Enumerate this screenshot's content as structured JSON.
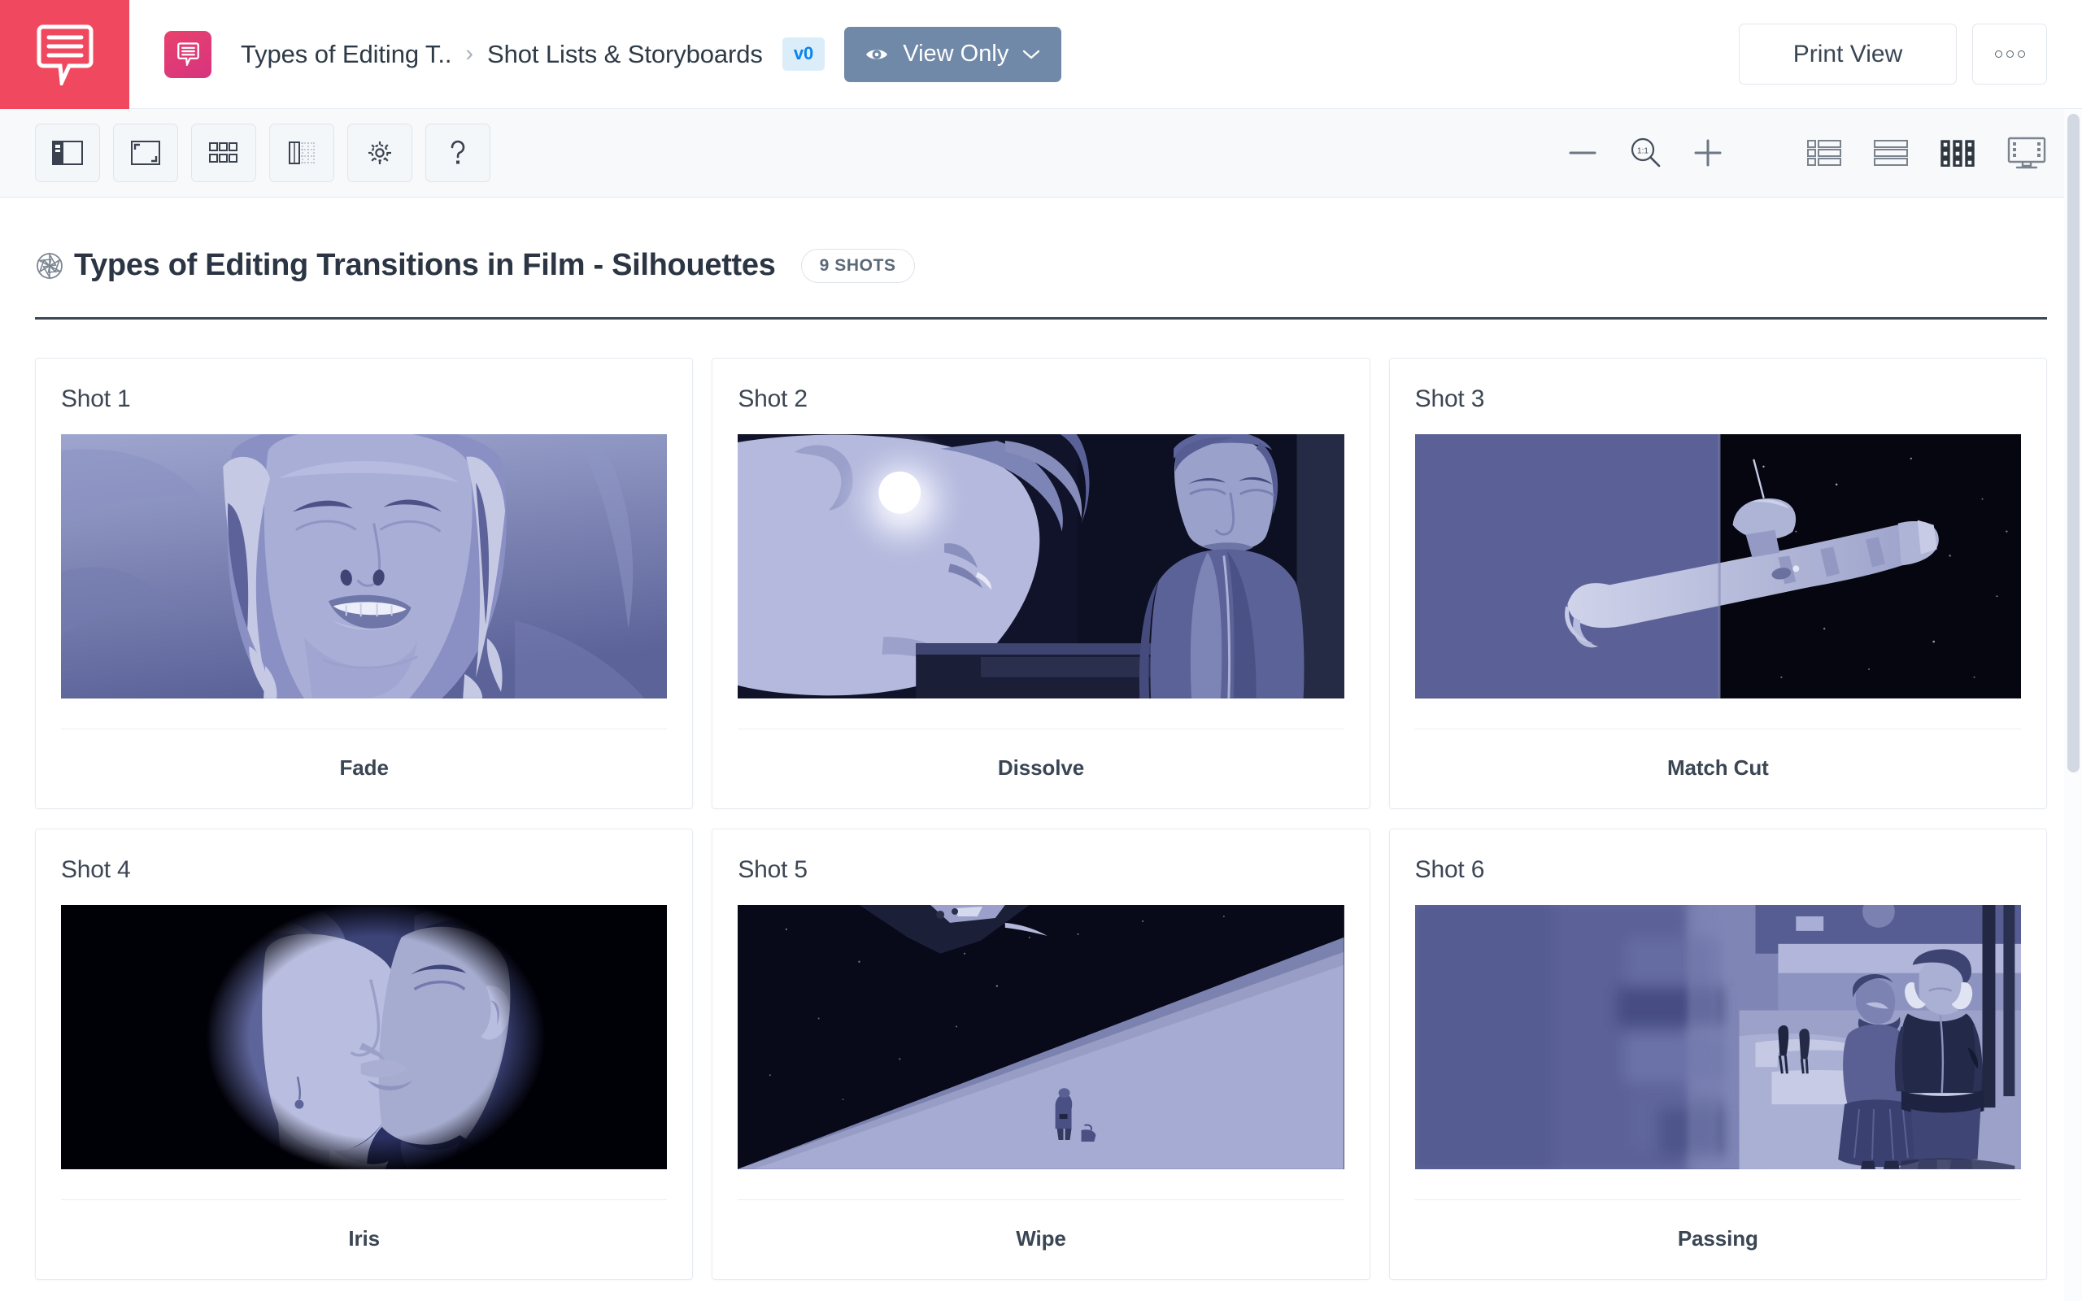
{
  "app": {
    "brand_color": "#f0495f",
    "logo_icon": "speech-bubble-lines-icon"
  },
  "header": {
    "project_chip_icon": "speech-bubble-lines-icon",
    "breadcrumb": {
      "project": "Types of Editing T..",
      "separator": "›",
      "section": "Shot Lists & Storyboards"
    },
    "version_badge": "v0",
    "version_badge_bg": "#dcedfa",
    "version_badge_color": "#0b84e8",
    "view_mode_button": {
      "label": "View Only",
      "icon": "eye-icon",
      "chevron": "chevron-down-icon",
      "bg": "#7089a8"
    },
    "print_view_label": "Print View",
    "more_options_icon": "three-dots-icon"
  },
  "toolbar": {
    "left_buttons": [
      {
        "name": "sidebar-toggle",
        "icon": "sidebar-panel-icon",
        "active": true
      },
      {
        "name": "fit-to-screen",
        "icon": "expand-corners-icon",
        "active": false
      },
      {
        "name": "grid-layout",
        "icon": "six-squares-icon",
        "active": false
      },
      {
        "name": "column-layout",
        "icon": "columns-icon",
        "active": false
      },
      {
        "name": "settings",
        "icon": "gear-icon",
        "active": false
      },
      {
        "name": "help",
        "icon": "question-mark-icon",
        "active": false
      }
    ],
    "zoom": {
      "out_icon": "minus-icon",
      "reset_icon": "magnifier-one-to-one-icon",
      "reset_label": "1:1",
      "in_icon": "plus-icon"
    },
    "view_modes": [
      {
        "name": "list-view",
        "icon": "list-view-icon",
        "active": false
      },
      {
        "name": "rows-view",
        "icon": "rows-view-icon",
        "active": false
      },
      {
        "name": "grid-view",
        "icon": "grid-view-icon",
        "active": true
      },
      {
        "name": "presentation-view",
        "icon": "monitor-view-icon",
        "active": false
      }
    ]
  },
  "board": {
    "icon": "aperture-icon",
    "title": "Types of Editing Transitions in Film - Silhouettes",
    "shots_badge": "9 SHOTS"
  },
  "shots": [
    {
      "number": "Shot 1",
      "label": "Fade",
      "art": "fade"
    },
    {
      "number": "Shot 2",
      "label": "Dissolve",
      "art": "dissolve"
    },
    {
      "number": "Shot 3",
      "label": "Match Cut",
      "art": "matchcut"
    },
    {
      "number": "Shot 4",
      "label": "Iris",
      "art": "iris"
    },
    {
      "number": "Shot 5",
      "label": "Wipe",
      "art": "wipe"
    },
    {
      "number": "Shot 6",
      "label": "Passing",
      "art": "passing"
    }
  ],
  "palette": {
    "lavender_light": "#b9bdde",
    "lavender_mid": "#9ba2cc",
    "indigo_deep": "#4b5288",
    "near_black": "#07070f",
    "slate_text": "#3b4654"
  }
}
